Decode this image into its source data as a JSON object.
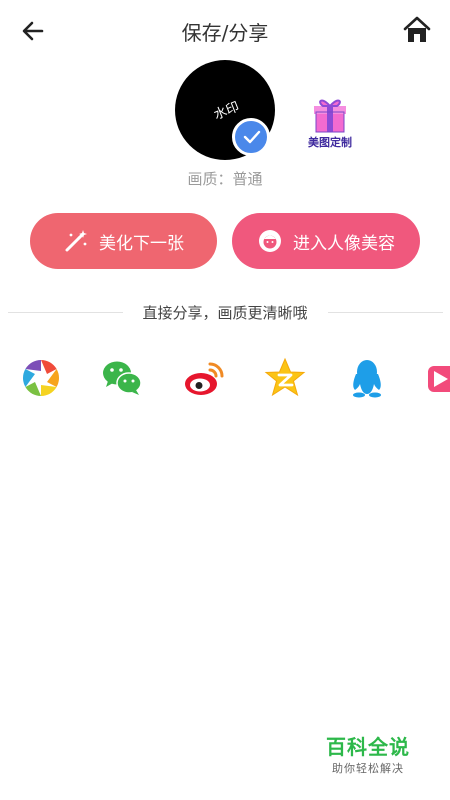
{
  "header": {
    "title": "保存/分享"
  },
  "preview": {
    "watermark": "水印"
  },
  "custom": {
    "label": "美图定制"
  },
  "quality": {
    "text": "画质：普通"
  },
  "actions": {
    "next_label": "美化下一张",
    "portrait_label": "进入人像美容"
  },
  "share": {
    "title": "直接分享，画质更清晰哦",
    "targets": [
      "photo-app",
      "wechat",
      "weibo",
      "qzone",
      "qq",
      "video-app"
    ]
  },
  "logo": {
    "main": "百科全说",
    "sub": "助你轻松解决"
  },
  "colors": {
    "next_button": "#ef6670",
    "portrait_button": "#f0587d",
    "check": "#4a88ea"
  }
}
